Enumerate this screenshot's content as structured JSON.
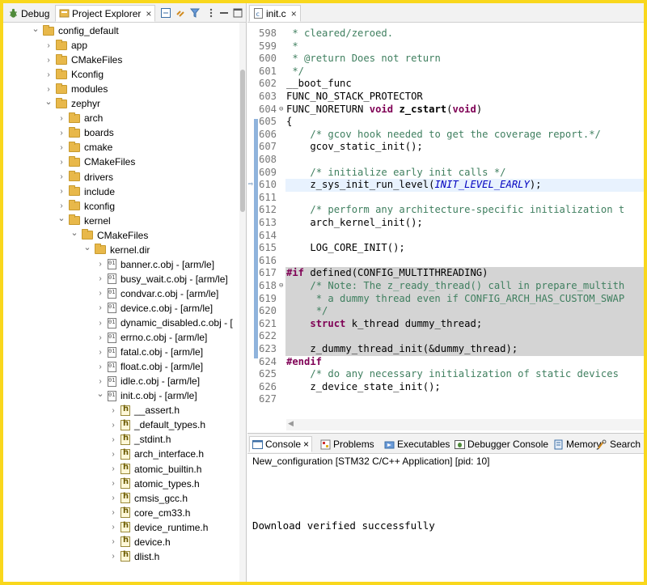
{
  "left_tabs": {
    "debug": "Debug",
    "project_explorer": "Project Explorer",
    "close": "×"
  },
  "tree": [
    {
      "label": "config_default",
      "type": "folder",
      "open": true,
      "depth": 0
    },
    {
      "label": "app",
      "type": "folder",
      "open": false,
      "depth": 1
    },
    {
      "label": "CMakeFiles",
      "type": "folder",
      "open": false,
      "depth": 1
    },
    {
      "label": "Kconfig",
      "type": "folder",
      "open": false,
      "depth": 1
    },
    {
      "label": "modules",
      "type": "folder",
      "open": false,
      "depth": 1
    },
    {
      "label": "zephyr",
      "type": "folder",
      "open": true,
      "depth": 1
    },
    {
      "label": "arch",
      "type": "folder",
      "open": false,
      "depth": 2
    },
    {
      "label": "boards",
      "type": "folder",
      "open": false,
      "depth": 2
    },
    {
      "label": "cmake",
      "type": "folder",
      "open": false,
      "depth": 2
    },
    {
      "label": "CMakeFiles",
      "type": "folder",
      "open": false,
      "depth": 2
    },
    {
      "label": "drivers",
      "type": "folder",
      "open": false,
      "depth": 2
    },
    {
      "label": "include",
      "type": "folder",
      "open": false,
      "depth": 2
    },
    {
      "label": "kconfig",
      "type": "folder",
      "open": false,
      "depth": 2
    },
    {
      "label": "kernel",
      "type": "folder",
      "open": true,
      "depth": 2
    },
    {
      "label": "CMakeFiles",
      "type": "folder",
      "open": true,
      "depth": 3
    },
    {
      "label": "kernel.dir",
      "type": "folder",
      "open": true,
      "depth": 4
    },
    {
      "label": "banner.c.obj - [arm/le]",
      "type": "obj",
      "open": false,
      "depth": 5
    },
    {
      "label": "busy_wait.c.obj - [arm/le]",
      "type": "obj",
      "open": false,
      "depth": 5
    },
    {
      "label": "condvar.c.obj - [arm/le]",
      "type": "obj",
      "open": false,
      "depth": 5
    },
    {
      "label": "device.c.obj - [arm/le]",
      "type": "obj",
      "open": false,
      "depth": 5
    },
    {
      "label": "dynamic_disabled.c.obj - [",
      "type": "obj",
      "open": false,
      "depth": 5
    },
    {
      "label": "errno.c.obj - [arm/le]",
      "type": "obj",
      "open": false,
      "depth": 5
    },
    {
      "label": "fatal.c.obj - [arm/le]",
      "type": "obj",
      "open": false,
      "depth": 5
    },
    {
      "label": "float.c.obj - [arm/le]",
      "type": "obj",
      "open": false,
      "depth": 5
    },
    {
      "label": "idle.c.obj - [arm/le]",
      "type": "obj",
      "open": false,
      "depth": 5
    },
    {
      "label": "init.c.obj - [arm/le]",
      "type": "obj",
      "open": true,
      "depth": 5
    },
    {
      "label": "__assert.h",
      "type": "header",
      "open": false,
      "depth": 6
    },
    {
      "label": "_default_types.h",
      "type": "header",
      "open": false,
      "depth": 6
    },
    {
      "label": "_stdint.h",
      "type": "header",
      "open": false,
      "depth": 6
    },
    {
      "label": "arch_interface.h",
      "type": "header",
      "open": false,
      "depth": 6
    },
    {
      "label": "atomic_builtin.h",
      "type": "header",
      "open": false,
      "depth": 6
    },
    {
      "label": "atomic_types.h",
      "type": "header",
      "open": false,
      "depth": 6
    },
    {
      "label": "cmsis_gcc.h",
      "type": "header",
      "open": false,
      "depth": 6
    },
    {
      "label": "core_cm33.h",
      "type": "header",
      "open": false,
      "depth": 6
    },
    {
      "label": "device_runtime.h",
      "type": "header",
      "open": false,
      "depth": 6
    },
    {
      "label": "device.h",
      "type": "header",
      "open": false,
      "depth": 6
    },
    {
      "label": "dlist.h",
      "type": "header",
      "open": false,
      "depth": 6
    }
  ],
  "editor": {
    "tab_label": "init.c",
    "close": "×",
    "lines": [
      {
        "n": "598",
        "text": " * cleared/zeroed.",
        "kind": "comment"
      },
      {
        "n": "599",
        "text": " *",
        "kind": "comment"
      },
      {
        "n": "600",
        "text": " * @return Does not return",
        "kind": "comment"
      },
      {
        "n": "601",
        "text": " */",
        "kind": "comment"
      },
      {
        "n": "602",
        "text": "__boot_func",
        "kind": "plain"
      },
      {
        "n": "603",
        "text": "FUNC_NO_STACK_PROTECTOR",
        "kind": "plain"
      },
      {
        "n": "604",
        "text": "FUNC_NORETURN void z_cstart(void)",
        "kind": "signature",
        "fold": true
      },
      {
        "n": "605",
        "text": "{",
        "kind": "plain"
      },
      {
        "n": "606",
        "text": "    /* gcov hook needed to get the coverage report.*/",
        "kind": "comment"
      },
      {
        "n": "607",
        "text": "    gcov_static_init();",
        "kind": "plain"
      },
      {
        "n": "608",
        "text": "",
        "kind": "plain"
      },
      {
        "n": "609",
        "text": "    /* initialize early init calls */",
        "kind": "comment"
      },
      {
        "n": "610",
        "text": "    z_sys_init_run_level(INIT_LEVEL_EARLY);",
        "kind": "current"
      },
      {
        "n": "611",
        "text": "",
        "kind": "plain"
      },
      {
        "n": "612",
        "text": "    /* perform any architecture-specific initialization t",
        "kind": "comment"
      },
      {
        "n": "613",
        "text": "    arch_kernel_init();",
        "kind": "plain"
      },
      {
        "n": "614",
        "text": "",
        "kind": "plain"
      },
      {
        "n": "615",
        "text": "    LOG_CORE_INIT();",
        "kind": "plain"
      },
      {
        "n": "616",
        "text": "",
        "kind": "plain"
      },
      {
        "n": "617",
        "text": "#if defined(CONFIG_MULTITHREADING)",
        "kind": "directive"
      },
      {
        "n": "618",
        "text": "    /* Note: The z_ready_thread() call in prepare_multith",
        "kind": "comment-inactive",
        "fold": true
      },
      {
        "n": "619",
        "text": "     * a dummy thread even if CONFIG_ARCH_HAS_CUSTOM_SWAP",
        "kind": "comment-inactive"
      },
      {
        "n": "620",
        "text": "     */",
        "kind": "comment-inactive"
      },
      {
        "n": "621",
        "text": "    struct k_thread dummy_thread;",
        "kind": "struct-inactive"
      },
      {
        "n": "622",
        "text": "",
        "kind": "inactive"
      },
      {
        "n": "623",
        "text": "    z_dummy_thread_init(&dummy_thread);",
        "kind": "inactive"
      },
      {
        "n": "624",
        "text": "#endif",
        "kind": "endif"
      },
      {
        "n": "625",
        "text": "    /* do any necessary initialization of static devices",
        "kind": "comment"
      },
      {
        "n": "626",
        "text": "    z_device_state_init();",
        "kind": "plain"
      },
      {
        "n": "627",
        "text": "",
        "kind": "plain"
      }
    ]
  },
  "console": {
    "tabs": [
      {
        "label": "Console",
        "active": true,
        "icon": "console-icon"
      },
      {
        "label": "Problems",
        "active": false,
        "icon": "problems-icon"
      },
      {
        "label": "Executables",
        "active": false,
        "icon": "executables-icon"
      },
      {
        "label": "Debugger Console",
        "active": false,
        "icon": "debugger-console-icon"
      },
      {
        "label": "Memory",
        "active": false,
        "icon": "memory-icon"
      },
      {
        "label": "Search",
        "active": false,
        "icon": "search-icon"
      }
    ],
    "close": "×",
    "title": "New_configuration [STM32 C/C++ Application]  [pid: 10]",
    "output": "Download verified successfully"
  },
  "colors": {
    "frame": "#f9d71c",
    "comment": "#3f7f5f",
    "keyword": "#7f0055",
    "enum": "#0000c0",
    "inactive_bg": "#d4d4d4",
    "current_line_bg": "#e8f2fe"
  }
}
